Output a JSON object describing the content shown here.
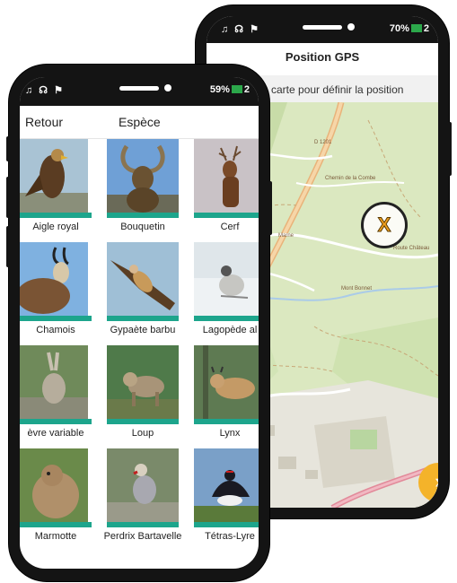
{
  "gps_screen": {
    "status": {
      "left_icons": "♫ ☊ ⚑",
      "battery": "70%",
      "extra": "2"
    },
    "title": "Position GPS",
    "hint": "Cliquez sur la carte pour définir la position",
    "hint_visible": "e carte pour définir la position",
    "marker_label": "X",
    "next_button": "›",
    "map_labels": [
      "D 1201",
      "Chemin de la Combe",
      "Route Château",
      "Mont Bonnet",
      "Marne"
    ]
  },
  "species_screen": {
    "status": {
      "left_icons": "♫ ☊ ⚑",
      "battery": "59%",
      "extra": "2"
    },
    "back_label": "Retour",
    "title": "Espèce",
    "species": [
      {
        "label": "Aigle royal"
      },
      {
        "label": "Bouquetin"
      },
      {
        "label": "Cerf"
      },
      {
        "label": "Chamois"
      },
      {
        "label": "Gypaète barbu"
      },
      {
        "label": "Lagopède alpin"
      },
      {
        "label": "Lièvre variable"
      },
      {
        "label": "Loup"
      },
      {
        "label": "Lynx"
      },
      {
        "label": "Marmotte"
      },
      {
        "label": "Perdrix Bartavelle"
      },
      {
        "label": "Tétras-Lyre"
      }
    ],
    "visible_captions": [
      "Aigle royal",
      "Bouquetin",
      "Cerf",
      "Chamois",
      "Gypaète barbu",
      "Lagopède al",
      "èvre variable",
      "Loup",
      "Lynx",
      "Marmotte",
      "Perdrix Bartavelle",
      "Tétras-Lyre"
    ]
  },
  "colors": {
    "accent": "#1da58c",
    "next_button": "#f4b32a",
    "marker_x": "#f0a020",
    "map_bg": "#dbe8c0"
  }
}
